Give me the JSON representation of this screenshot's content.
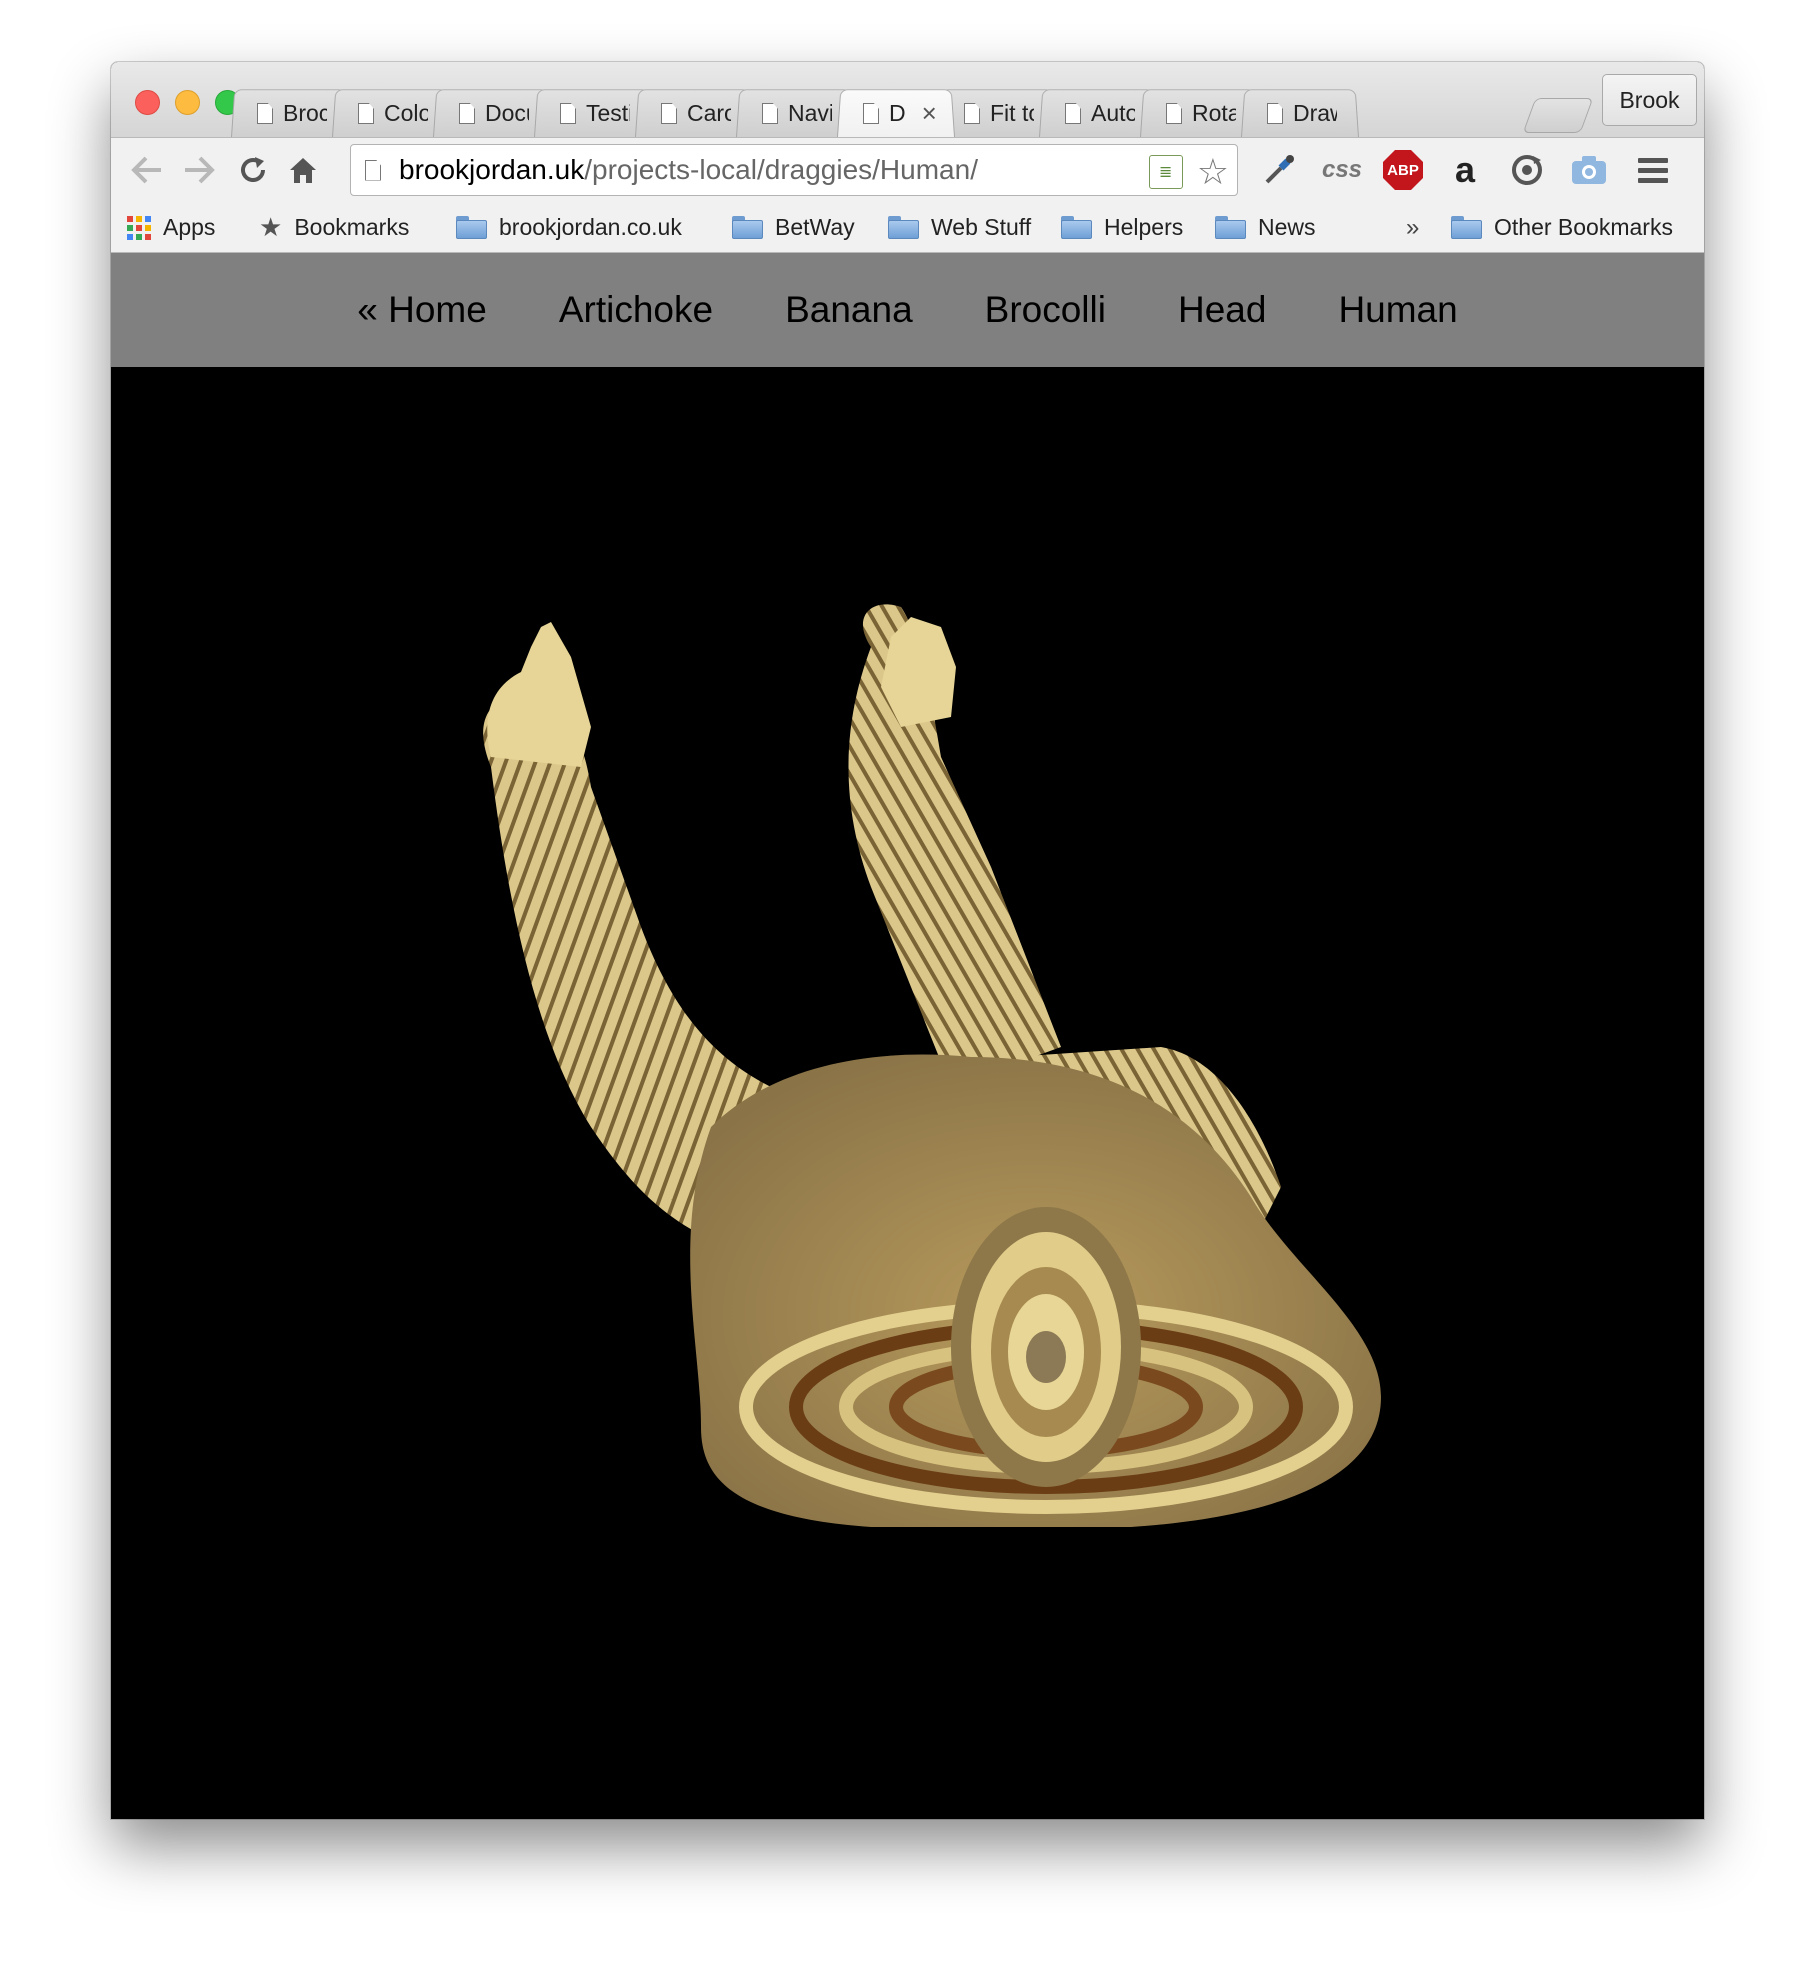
{
  "browser": {
    "tabs": [
      {
        "title": "Broc"
      },
      {
        "title": "Colo"
      },
      {
        "title": "Docu"
      },
      {
        "title": "Testi"
      },
      {
        "title": "Caro"
      },
      {
        "title": "Navi"
      },
      {
        "title": "D",
        "active": true
      },
      {
        "title": "Fit to"
      },
      {
        "title": "Auto"
      },
      {
        "title": "Rota"
      },
      {
        "title": "Draw"
      }
    ],
    "profile_name": "Brook",
    "url_host": "brookjordan.uk",
    "url_path": "/projects-local/draggies/Human/",
    "extensions": {
      "css_label": "css",
      "abp_label": "ABP",
      "amazon_label": "a"
    },
    "bookmarks": {
      "apps": "Apps",
      "bookmarks": "Bookmarks",
      "folders": [
        "brookjordan.co.uk",
        "BetWay",
        "Web Stuff",
        "Helpers",
        "News"
      ],
      "overflow": "»",
      "other": "Other Bookmarks"
    }
  },
  "site_nav": {
    "home": "« Home",
    "items": [
      "Artichoke",
      "Banana",
      "Brocolli",
      "Head",
      "Human"
    ]
  },
  "colors": {
    "nav_bg": "#808080",
    "canvas_bg": "#000000",
    "model_light": "#e6d596",
    "model_dark": "#6b3d14"
  }
}
